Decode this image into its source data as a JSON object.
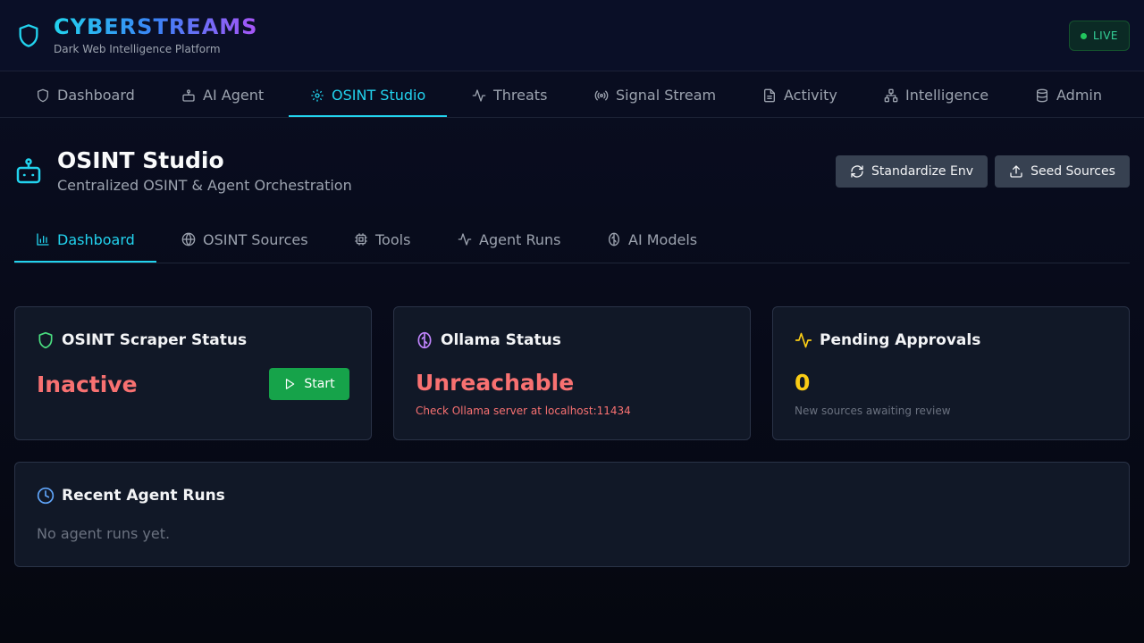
{
  "app": {
    "title": "CYBERSTREAMS",
    "subtitle": "Dark Web Intelligence Platform",
    "live_label": "LIVE"
  },
  "nav": {
    "items": [
      {
        "label": "Dashboard",
        "icon": "shield-icon"
      },
      {
        "label": "AI Agent",
        "icon": "robot-icon"
      },
      {
        "label": "OSINT Studio",
        "icon": "gear-icon",
        "active": true
      },
      {
        "label": "Threats",
        "icon": "activity-icon"
      },
      {
        "label": "Signal Stream",
        "icon": "radio-icon"
      },
      {
        "label": "Activity",
        "icon": "document-icon"
      },
      {
        "label": "Intelligence",
        "icon": "network-icon"
      },
      {
        "label": "Admin",
        "icon": "database-icon"
      }
    ]
  },
  "page": {
    "title": "OSINT Studio",
    "subtitle": "Centralized OSINT & Agent Orchestration",
    "standardize_label": "Standardize Env",
    "seed_label": "Seed Sources"
  },
  "subtabs": {
    "items": [
      {
        "label": "Dashboard",
        "icon": "bar-chart-icon",
        "active": true
      },
      {
        "label": "OSINT Sources",
        "icon": "globe-icon"
      },
      {
        "label": "Tools",
        "icon": "cpu-icon"
      },
      {
        "label": "Agent Runs",
        "icon": "activity-icon"
      },
      {
        "label": "AI Models",
        "icon": "brain-icon"
      }
    ]
  },
  "cards": {
    "scraper": {
      "title": "OSINT Scraper Status",
      "status": "Inactive",
      "start_label": "Start"
    },
    "ollama": {
      "title": "Ollama Status",
      "status": "Unreachable",
      "note": "Check Ollama server at localhost:11434"
    },
    "approvals": {
      "title": "Pending Approvals",
      "count": "0",
      "note": "New sources awaiting review"
    },
    "runs": {
      "title": "Recent Agent Runs",
      "empty": "No agent runs yet."
    }
  },
  "colors": {
    "accent": "#22d3ee",
    "danger": "#f87171",
    "warning": "#facc15",
    "success": "#16a34a",
    "card_bg": "#111827"
  }
}
